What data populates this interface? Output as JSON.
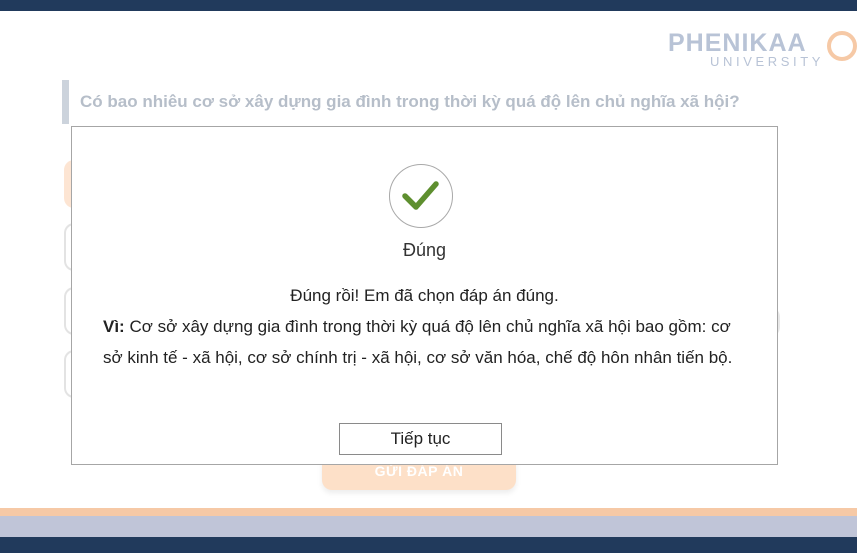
{
  "brand": {
    "name": "PHENIKAA",
    "subtitle": "UNIVERSITY"
  },
  "question": {
    "text": "Có bao nhiêu cơ sở xây dựng gia đình trong thời kỳ quá độ lên chủ nghĩa xã hội?"
  },
  "submit": {
    "label": "GỬI ĐÁP ÁN"
  },
  "feedback": {
    "status": "Đúng",
    "message": "Đúng rồi! Em đã chọn đáp án đúng.",
    "explanation_label": "Vì:",
    "explanation_text": " Cơ sở xây dựng gia đình trong thời kỳ quá độ lên chủ nghĩa xã hội bao gồm: cơ sở kinh tế - xã hội, cơ sở chính trị - xã hội, cơ sở văn hóa, chế độ hôn nhân tiến bộ.",
    "continue_label": "Tiếp tục",
    "icon": "check-icon",
    "accent_color": "#5e8f2f"
  },
  "colors": {
    "navy": "#213a5c",
    "peach": "#f6c9a6",
    "lavender": "#c0c5d8"
  }
}
